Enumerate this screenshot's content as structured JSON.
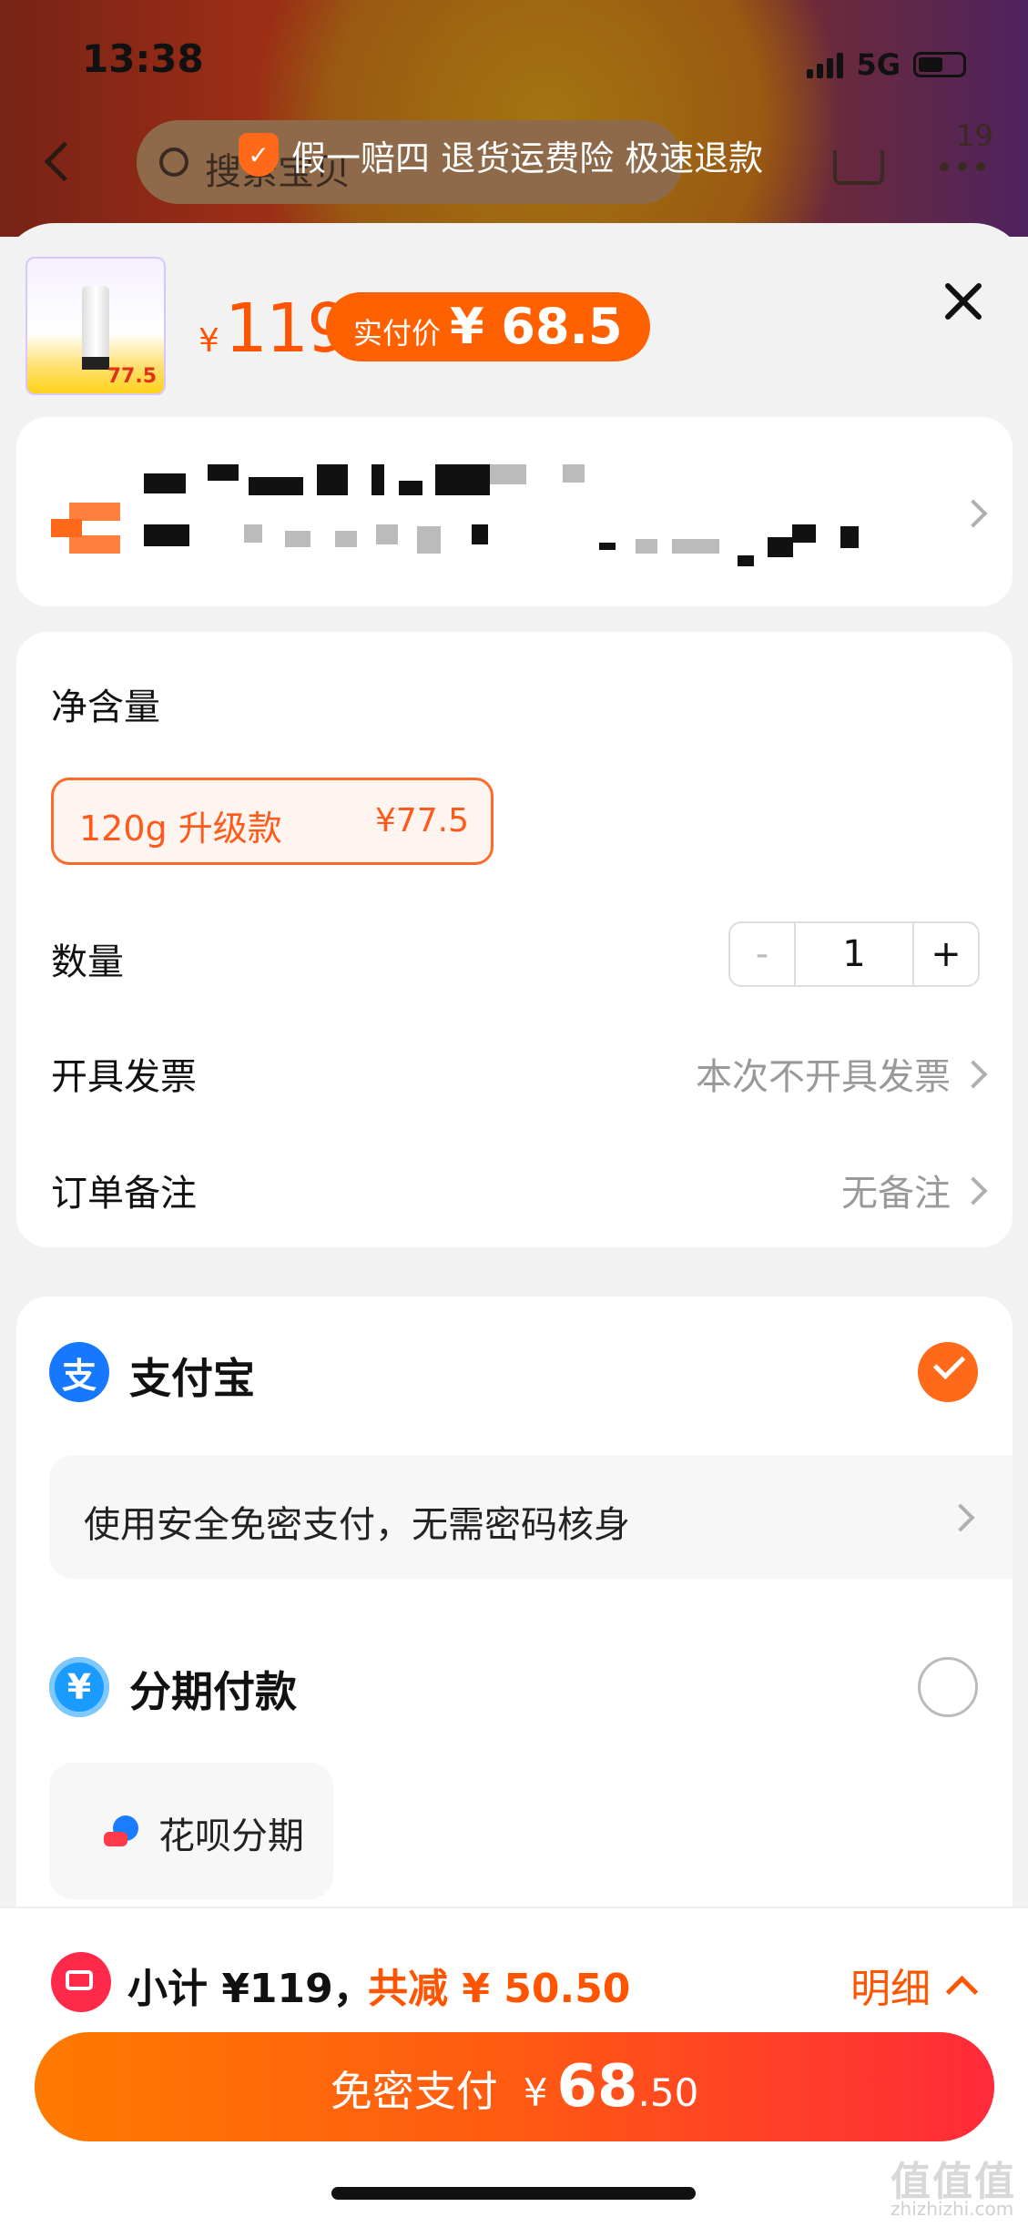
{
  "status_bar": {
    "time": "13:38",
    "network": "5G"
  },
  "background_page": {
    "search_placeholder": "搜索宝贝",
    "cart_badge": "19"
  },
  "banner": {
    "text": "假一赔四 退货运费险 极速退款"
  },
  "product": {
    "thumb_price": "77.5",
    "price_yen": "¥",
    "price": "119",
    "real_price_label": "实付价",
    "real_price_value": "¥ 68.5"
  },
  "options": {
    "net_content_label": "净含量",
    "sku_name": "120g 升级款",
    "sku_price": "¥77.5",
    "quantity_label": "数量",
    "quantity_minus": "-",
    "quantity_value": "1",
    "quantity_plus": "+",
    "invoice_label": "开具发票",
    "invoice_value": "本次不开具发票",
    "note_label": "订单备注",
    "note_value": "无备注"
  },
  "payment": {
    "alipay_label": "支付宝",
    "alipay_icon_glyph": "支",
    "no_password_text": "使用安全免密支付，无需密码核身",
    "installment_label": "分期付款",
    "installment_icon_glyph": "¥",
    "huabei_label": "花呗分期",
    "selected": "alipay"
  },
  "summary": {
    "subtotal": "小计 ¥119，",
    "discount": "共减 ¥ 50.50",
    "detail_label": "明细"
  },
  "pay_button": {
    "label": "免密支付",
    "yen": "¥",
    "amount_int": "68",
    "amount_dec": ".50"
  },
  "watermark": {
    "text": "值值值",
    "sub": "zhizhizhi.com"
  },
  "colors": {
    "accent": "#ff5500",
    "alipay_blue": "#1677ff",
    "installment_blue": "#1a9bff"
  }
}
